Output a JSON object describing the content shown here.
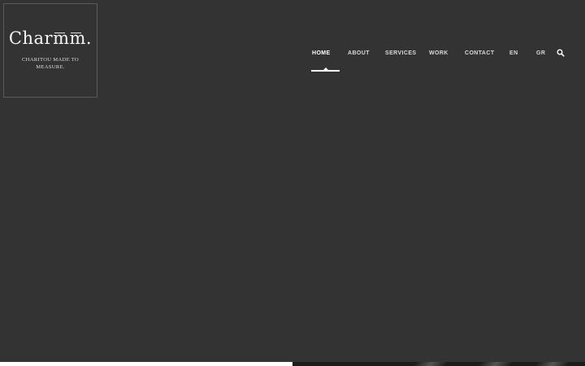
{
  "logo": {
    "name": "Charmm.",
    "tagline": "CHARITOU MADE TO MEASURE."
  },
  "nav": {
    "items": [
      {
        "label": "HOME",
        "active": true
      },
      {
        "label": "ABOUT",
        "active": false
      },
      {
        "label": "SERVICES",
        "active": false
      },
      {
        "label": "WORK",
        "active": false
      },
      {
        "label": "CONTACT",
        "active": false
      },
      {
        "label": "EN",
        "active": false
      },
      {
        "label": "GR",
        "active": false
      }
    ],
    "search_icon": "search-icon"
  },
  "colors": {
    "background": "#333333",
    "nav_text": "#d9d9d9",
    "active": "#ffffff"
  }
}
